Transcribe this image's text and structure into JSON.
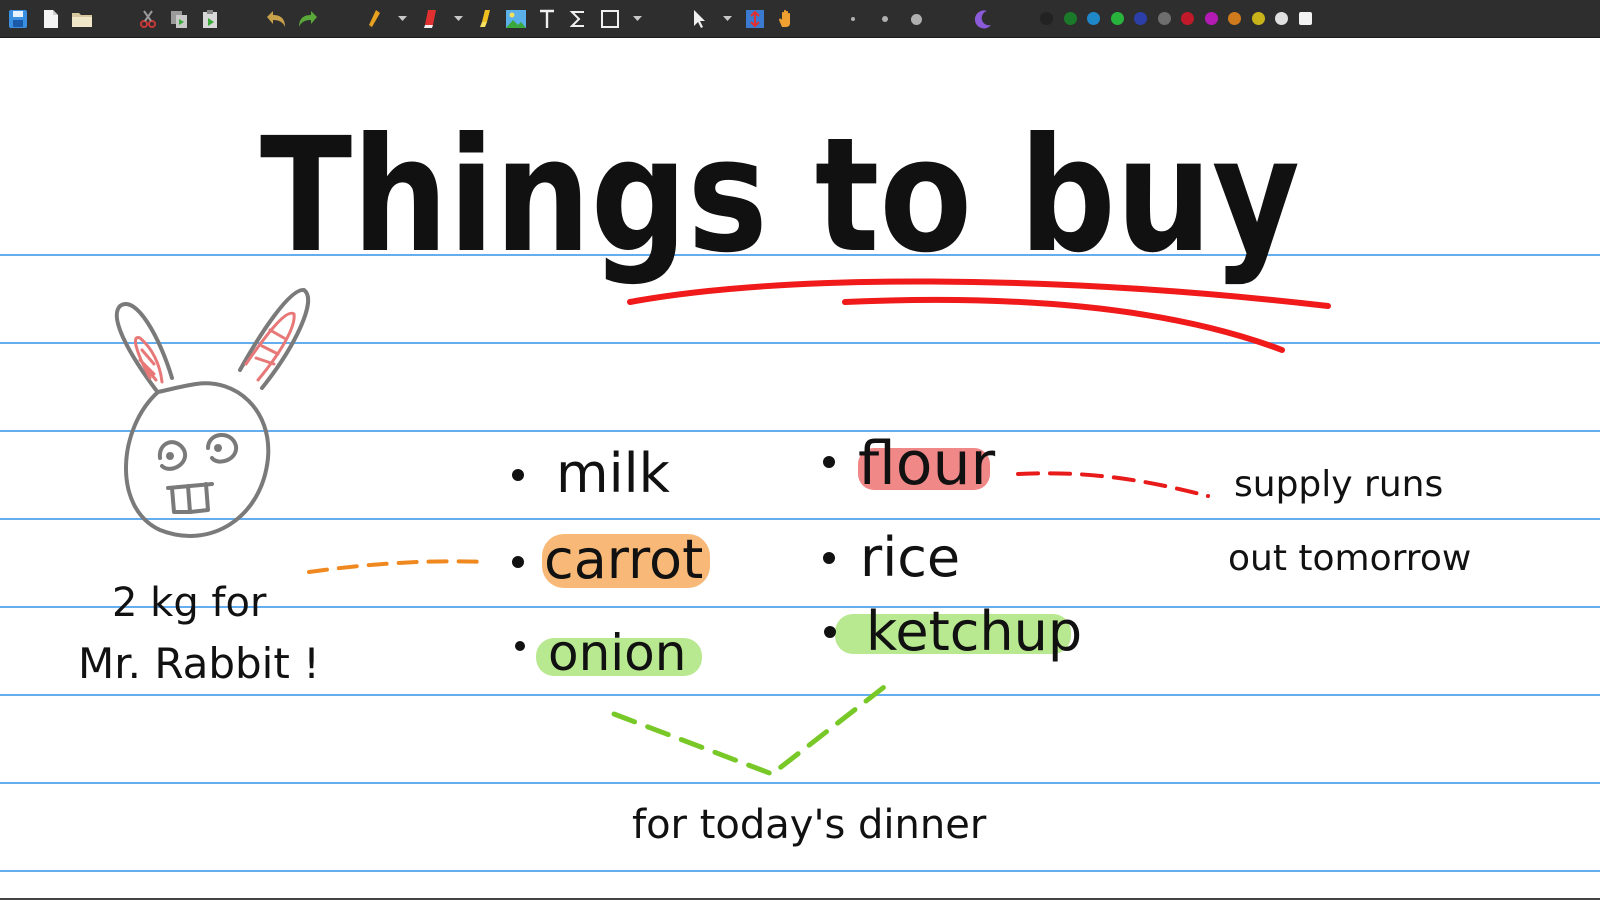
{
  "toolbar": {
    "buttons": [
      {
        "name": "save-button",
        "icon": "save-icon"
      },
      {
        "name": "new-page-button",
        "icon": "new-document-icon"
      },
      {
        "name": "open-button",
        "icon": "folder-icon"
      },
      {
        "name": "cut-button",
        "icon": "scissors-icon"
      },
      {
        "name": "copy-button",
        "icon": "copy-icon"
      },
      {
        "name": "paste-button",
        "icon": "paste-icon"
      },
      {
        "name": "undo-button",
        "icon": "undo-icon"
      },
      {
        "name": "redo-button",
        "icon": "redo-icon"
      },
      {
        "name": "pen-tool-button",
        "icon": "pen-icon"
      },
      {
        "name": "eraser-tool-button",
        "icon": "eraser-icon"
      },
      {
        "name": "highlighter-tool-button",
        "icon": "highlighter-icon"
      },
      {
        "name": "image-tool-button",
        "icon": "image-icon"
      },
      {
        "name": "text-tool-button",
        "icon": "text-icon"
      },
      {
        "name": "latex-tool-button",
        "icon": "sigma-icon"
      },
      {
        "name": "shape-tool-button",
        "icon": "rectangle-icon"
      },
      {
        "name": "select-tool-button",
        "icon": "pointer-icon"
      },
      {
        "name": "vertical-space-button",
        "icon": "vertical-space-icon"
      },
      {
        "name": "hand-tool-button",
        "icon": "hand-icon"
      },
      {
        "name": "fine-size-button",
        "icon": "small-dot-icon"
      },
      {
        "name": "medium-size-button",
        "icon": "medium-dot-icon"
      },
      {
        "name": "thick-size-button",
        "icon": "large-dot-icon"
      },
      {
        "name": "color-picker-button",
        "icon": "color-picker-icon"
      }
    ],
    "palette": [
      "#222222",
      "#1a7a2a",
      "#1e88c8",
      "#27b33c",
      "#2c3ea8",
      "#6e6e6e",
      "#c01a2a",
      "#b41ab4",
      "#d07a1e",
      "#c8b41a",
      "#e0e0e0",
      "#f2f2f2"
    ],
    "colors": {
      "bar": "#2e2e2e",
      "save": "#3a8fe0",
      "undo": "#c8a24a",
      "redo": "#5aa83a",
      "pen": "#e8a020",
      "eraser": "#e03030",
      "highlighter": "#f0c020",
      "hand": "#f0a030",
      "vspace": "#3a7ad0",
      "colorpicker": "#8a5ad8"
    }
  },
  "page": {
    "title": "Things to buy",
    "items_left": [
      "milk",
      "carrot",
      "onion"
    ],
    "items_right": [
      "flour",
      "rice",
      "ketchup"
    ],
    "note_rabbit_line1": "2 kg for",
    "note_rabbit_line2": "Mr. Rabbit !",
    "note_supply_line1": "supply runs",
    "note_supply_line2": "out tomorrow",
    "note_dinner": "for today's dinner",
    "colors": {
      "ruled_line": "#64aef0",
      "underline": "#f01a1a",
      "highlight_flour": "#f08888",
      "highlight_carrot": "#f8b878",
      "highlight_green": "#b8e890",
      "connector_orange": "#f08820",
      "connector_red": "#e81a1a",
      "connector_green": "#78c828",
      "rabbit_outline": "#7a7a7a",
      "rabbit_ear": "#e87878"
    }
  }
}
